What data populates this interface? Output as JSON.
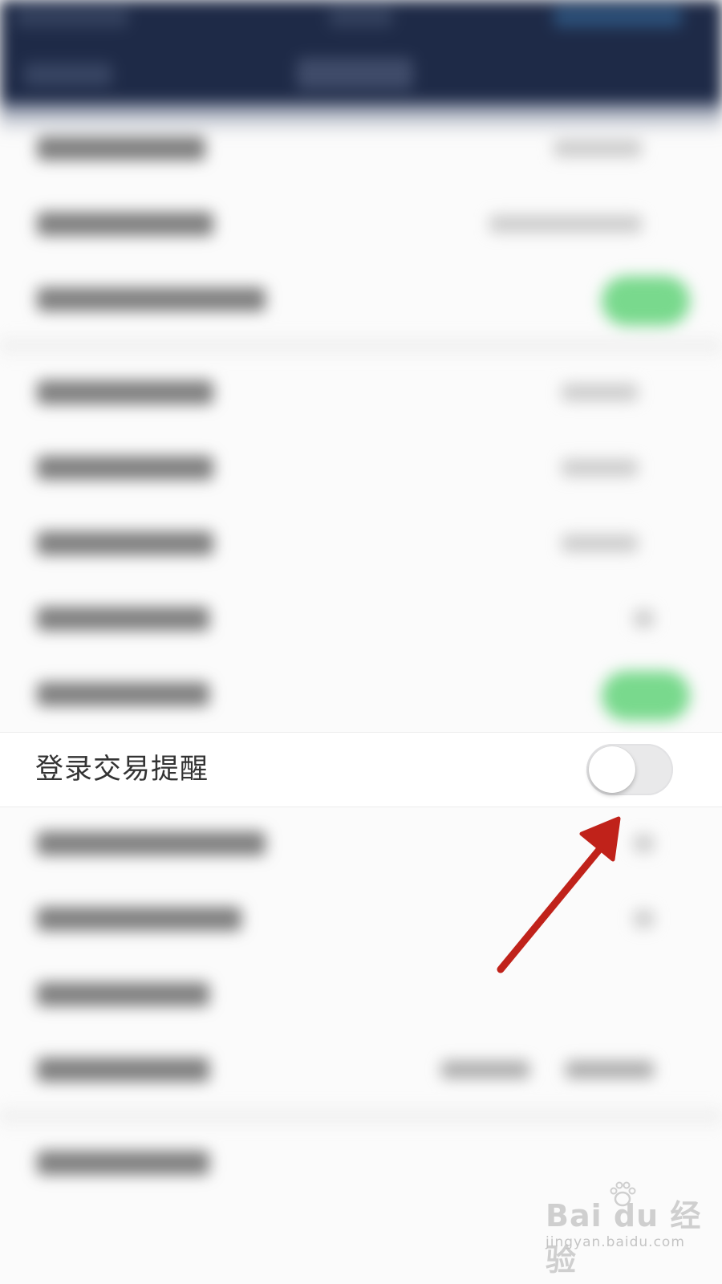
{
  "setting": {
    "label": "登录交易提醒",
    "enabled": false
  },
  "colors": {
    "header": "#1e2a47",
    "toggle_on": "#79d98d",
    "toggle_off": "#e9e9ea",
    "annotation_arrow": "#c0221a"
  },
  "annotation": {
    "icon": "arrow-pointer-icon"
  },
  "watermark": {
    "brand": "Bai du 经验",
    "url": "jingyan.baidu.com",
    "icon": "paw-icon"
  }
}
